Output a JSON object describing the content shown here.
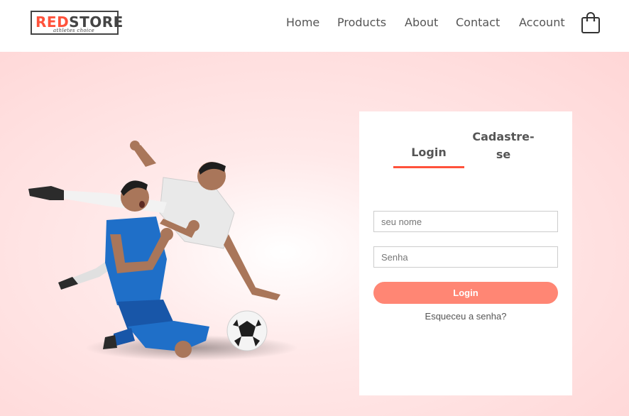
{
  "header": {
    "logo_brand_red": "RED",
    "logo_brand_dark": "STORE",
    "logo_tagline": "athletes choice",
    "nav": [
      {
        "label": "Home"
      },
      {
        "label": "Products"
      },
      {
        "label": "About"
      },
      {
        "label": "Contact"
      },
      {
        "label": "Account"
      }
    ],
    "cart_icon": "shopping-bag-icon"
  },
  "form": {
    "tab_login": "Login",
    "tab_register": "Cadastre-se",
    "username_placeholder": "seu nome",
    "password_placeholder": "Senha",
    "submit_label": "Login",
    "forgot_link": "Esqueceu a senha?"
  },
  "colors": {
    "accent": "#ff523b",
    "button": "#ff8674",
    "hero_bg": "#ffd6d6"
  }
}
